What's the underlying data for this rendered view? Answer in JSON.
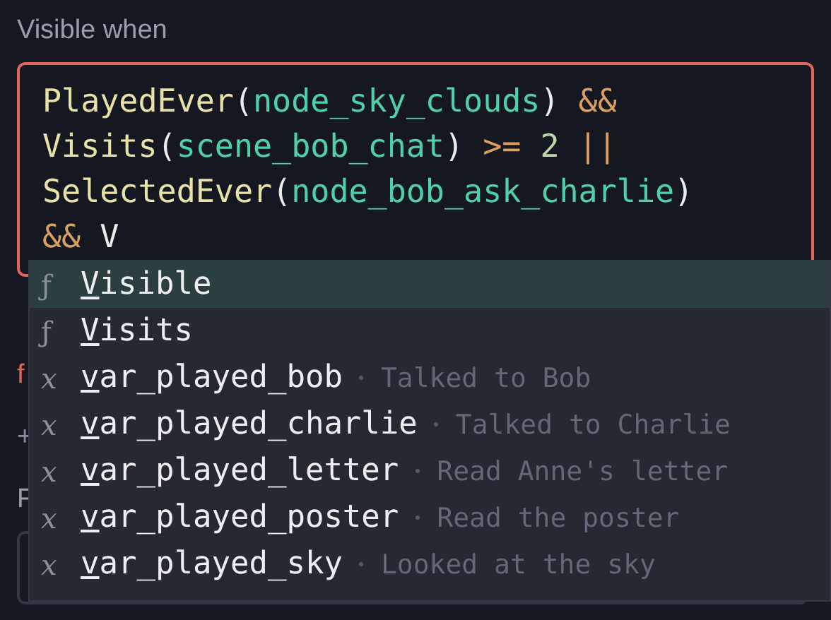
{
  "field_label": "Visible when",
  "editor": {
    "error": true,
    "lines": [
      [
        {
          "kind": "fn",
          "text": "PlayedEver"
        },
        {
          "kind": "punct",
          "text": "("
        },
        {
          "kind": "arg",
          "text": "node_sky_clouds"
        },
        {
          "kind": "punct",
          "text": ")"
        },
        {
          "kind": "op",
          "text": " &&"
        }
      ],
      [
        {
          "kind": "fn",
          "text": "Visits"
        },
        {
          "kind": "punct",
          "text": "("
        },
        {
          "kind": "arg",
          "text": "scene_bob_chat"
        },
        {
          "kind": "punct",
          "text": ")"
        },
        {
          "kind": "op",
          "text": " >="
        },
        {
          "kind": "num",
          "text": " 2"
        },
        {
          "kind": "op",
          "text": " ||"
        }
      ],
      [
        {
          "kind": "fn",
          "text": "SelectedEver"
        },
        {
          "kind": "punct",
          "text": "("
        },
        {
          "kind": "arg",
          "text": "node_bob_ask_charlie"
        },
        {
          "kind": "punct",
          "text": ")"
        }
      ],
      [
        {
          "kind": "op",
          "text": "&&"
        },
        {
          "kind": "punct",
          "text": " V"
        }
      ]
    ]
  },
  "behind": [
    {
      "kind": "error",
      "text": "f"
    },
    {
      "kind": "muted",
      "text": "+"
    },
    {
      "kind": "label",
      "text": "F"
    }
  ],
  "completions": [
    {
      "kind": "function",
      "icon": "ƒ",
      "name": "Visible",
      "selected": true
    },
    {
      "kind": "function",
      "icon": "ƒ",
      "name": "Visits",
      "selected": false
    },
    {
      "kind": "variable",
      "icon": "x",
      "name": "var_played_bob",
      "description": "Talked to Bob",
      "selected": false
    },
    {
      "kind": "variable",
      "icon": "x",
      "name": "var_played_charlie",
      "description": "Talked to Charlie",
      "selected": false
    },
    {
      "kind": "variable",
      "icon": "x",
      "name": "var_played_letter",
      "description": "Read Anne's letter",
      "selected": false
    },
    {
      "kind": "variable",
      "icon": "x",
      "name": "var_played_poster",
      "description": "Read the poster",
      "selected": false
    },
    {
      "kind": "variable",
      "icon": "x",
      "name": "var_played_sky",
      "description": "Looked at the sky",
      "selected": false
    }
  ]
}
